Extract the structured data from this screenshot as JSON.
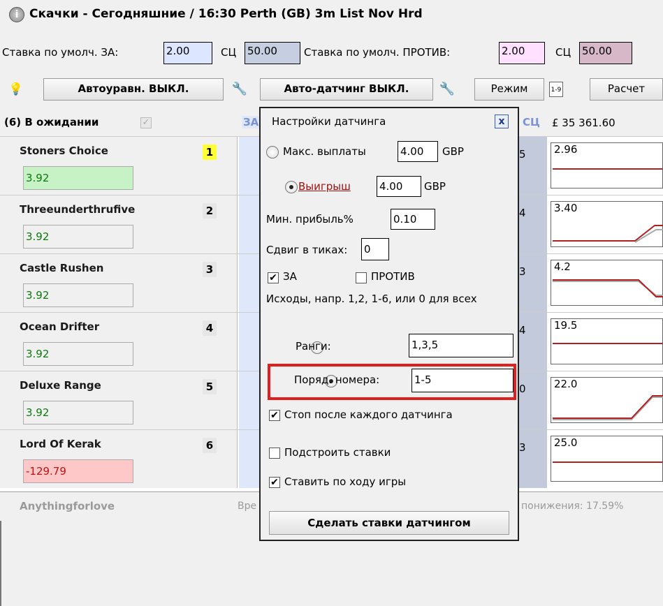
{
  "window": {
    "title": "Скачки - Сегодняшние / 16:30 Perth (GB) 3m List Nov Hrd"
  },
  "defaults": {
    "back_label": "Ставка по умолч. ЗА:",
    "back_value": "2.00",
    "sc_label1": "СЦ",
    "sc_value1": "50.00",
    "lay_label": "Ставка по умолч. ПРОТИВ:",
    "lay_value": "2.00",
    "sc_label2": "СЦ",
    "sc_value2": "50.00"
  },
  "toolbar": {
    "auto_equalize": "Автоуравн. ВЫКЛ.",
    "auto_dutching": "Авто-датчинг ВЫКЛ.",
    "mode": "Режим",
    "calc": "Расчет"
  },
  "market": {
    "status": "(6) В ожидании",
    "col_back": "ЗА",
    "col_sc": "СЦ",
    "total": "£ 35 361.60"
  },
  "runners": [
    {
      "name": "Stoners Choice",
      "num": "1",
      "price": "3.92",
      "odds_digit": "5",
      "last": "2.96",
      "price_color": "#c6f2c6",
      "num_bg": "#ffff33"
    },
    {
      "name": "Threeunderthrufive",
      "num": "2",
      "price": "3.92",
      "odds_digit": "4",
      "last": "3.40",
      "price_color": "#f0f0f0",
      "num_bg": "#e6e6e6"
    },
    {
      "name": "Castle Rushen",
      "num": "3",
      "price": "3.92",
      "odds_digit": "3",
      "last": "4.2",
      "price_color": "#f0f0f0",
      "num_bg": "#e6e6e6"
    },
    {
      "name": "Ocean Drifter",
      "num": "4",
      "price": "3.92",
      "odds_digit": "4",
      "last": "19.5",
      "price_color": "#f0f0f0",
      "num_bg": "#e6e6e6"
    },
    {
      "name": "Deluxe Range",
      "num": "5",
      "price": "3.92",
      "odds_digit": "0",
      "last": "22.0",
      "price_color": "#f0f0f0",
      "num_bg": "#e6e6e6"
    },
    {
      "name": "Lord Of Kerak",
      "num": "6",
      "price": "-129.79",
      "odds_digit": "3",
      "last": "25.0",
      "price_color": "#ffc8c8",
      "num_bg": "#e6e6e6"
    }
  ],
  "non_runner": {
    "name": "Anythingforlove",
    "prefix": "Вре",
    "suffix": "понижения: 17.59%"
  },
  "popup": {
    "title": "Настройки датчинга",
    "close": "x",
    "max_payout_label": "Макс. выплаты",
    "max_payout_value": "4.00",
    "currency": "GBP",
    "win_label": "Выигрыш",
    "win_value": "4.00",
    "min_profit_label": "Мин. прибыль%",
    "min_profit_value": "0.10",
    "tick_offset_label": "Сдвиг в тиках:",
    "tick_offset_value": "0",
    "back_label": "ЗА",
    "lay_label": "ПРОТИВ",
    "outcomes_hint": "Исходы, напр. 1,2, 1-6, или 0 для всех",
    "ranks_label": "Ранги:",
    "ranks_value": "1,3,5",
    "order_label": "Поряд. номера:",
    "order_value": "1-5",
    "stop_after": "Стоп после каждого датчинга",
    "adjust_stakes": "Подстроить ставки",
    "inplay": "Ставить по ходу игры",
    "submit": "Сделать ставки датчингом"
  }
}
